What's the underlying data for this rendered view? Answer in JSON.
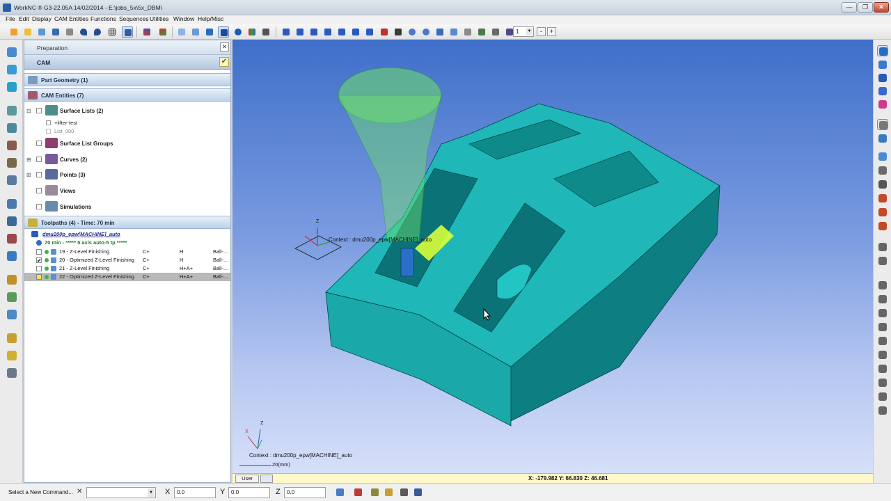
{
  "window": {
    "title": "WorkNC ® G3-22.05A  14/02/2014 - E:\\jobs_5x\\5x_DBM\\",
    "minimize": "—",
    "restore": "❐",
    "close": "✕"
  },
  "menu": [
    "File",
    "Edit",
    "Display",
    "CAM Entities",
    "Functions",
    "Sequences",
    "Utilities",
    "Window",
    "Help/Misc"
  ],
  "toolbar": {
    "layer_value": "1",
    "icons": [
      "new-icon",
      "open-icon",
      "open-workzone-icon",
      "save-icon",
      "print-icon",
      "undo-icon",
      "redo-icon",
      "grid-icon",
      "layout-icon",
      "axis-icon",
      "axis2-icon",
      "view-iso-icon",
      "view-box-icon",
      "view-solid-icon",
      "view-shaded-icon",
      "view-sphere-icon",
      "view-color-icon",
      "view-camera-icon",
      "rotate-icon",
      "rotate2-icon",
      "rotate3-icon",
      "rotate4-icon",
      "rotate5-icon",
      "rotate6-icon",
      "rotate7-icon",
      "zoom-window-icon",
      "zoom-all-icon",
      "zoom-in-icon",
      "zoom-out-icon",
      "pan-icon",
      "fit-icon",
      "select-icon",
      "filter-icon",
      "layer-icon"
    ],
    "plus": "+",
    "minus": "-"
  },
  "panel": {
    "header": "Preparation",
    "close": "✕",
    "cam_bar": "CAM",
    "cam_check": "✔",
    "part_geometry": "Part Geometry (1)",
    "cam_entities": "CAM Entities (7)",
    "tree": [
      {
        "label": "Surface Lists (2)",
        "expander": "⊟",
        "color": "#4e8e8a"
      },
      {
        "label": "Surface List Groups",
        "expander": "",
        "color": "#8e3e6e"
      },
      {
        "label": "Curves (2)",
        "expander": "⊞",
        "color": "#7a5a9a"
      },
      {
        "label": "Points (3)",
        "expander": "⊞",
        "color": "#5a6a9a"
      },
      {
        "label": "Views",
        "expander": "",
        "color": "#9a8a9a"
      },
      {
        "label": "Simulations",
        "expander": "",
        "color": "#6a8aaa"
      }
    ],
    "surface_lists": [
      "+lifter-test",
      "List_000"
    ],
    "toolpaths_header": "Toolpaths (4) - Time: 70 min",
    "machine": "dmu200p_epw[MACHINE]_auto",
    "sequence": "70 min - ***** 5 axis auto-5 tp *****",
    "toolpaths": [
      {
        "name": "19 - Z-Level Finishing",
        "side": "C+",
        "mode": "H",
        "tool": "Ball-...",
        "checked": "",
        "selected": false
      },
      {
        "name": "20 - Optimized Z-Level Finishing",
        "side": "C+",
        "mode": "H",
        "tool": "Ball-...",
        "checked": "✔",
        "selected": false
      },
      {
        "name": "21 - Z-Level Finishing",
        "side": "C+",
        "mode": "H+A+",
        "tool": "Ball-...",
        "checked": "",
        "selected": false
      },
      {
        "name": "22 - Optimized Z-Level Finishing",
        "side": "C+",
        "mode": "H+A+",
        "tool": "Ball-...",
        "checked": "",
        "selected": true
      }
    ]
  },
  "viewport": {
    "context_label": "Context : dmu200p_epw[MACHINE]_auto",
    "scale_label": "20(mm)",
    "axis_z": "Z",
    "axis_x": "X",
    "axis_y": "Y",
    "user_tab": "User",
    "coords": "X: -179.982   Y: 66.830   Z: 46.681"
  },
  "command_bar": {
    "placeholder": "Select a New Command...",
    "clear": "✕",
    "x_label": "X",
    "y_label": "Y",
    "z_label": "Z",
    "x_value": "0.0",
    "y_value": "0.0",
    "z_value": "0.0"
  },
  "colors": {
    "part": "#1aa8a8",
    "part_dark": "#0d7f82",
    "toolholder": "#6fe06a",
    "tool": "#2b6fc9",
    "toolpath": "#d8ff3a",
    "viewport_top": "#3f6fc9",
    "viewport_bottom": "#d6e0fa"
  }
}
